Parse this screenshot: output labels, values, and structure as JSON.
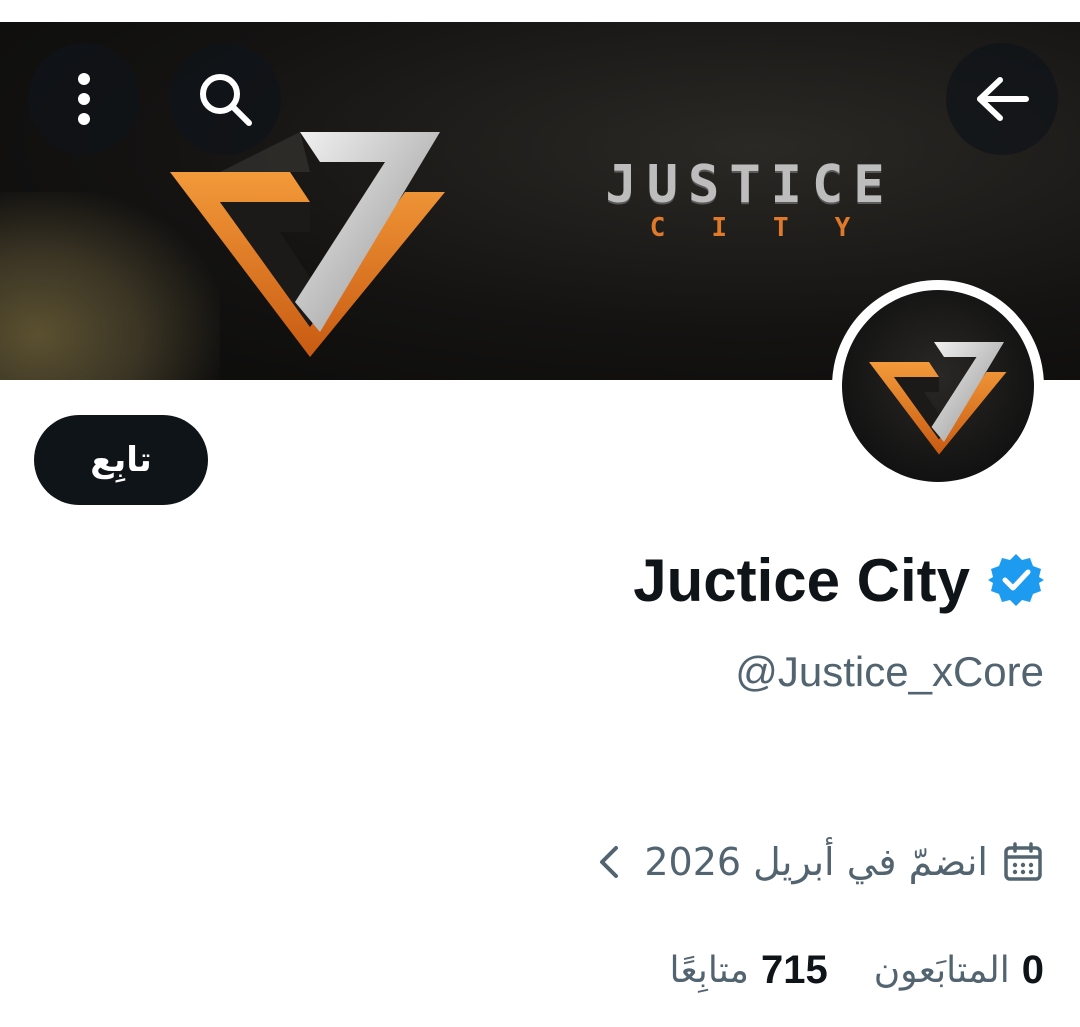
{
  "header": {
    "more_icon": "more-vertical-icon",
    "search_icon": "search-icon",
    "back_icon": "arrow-left-icon"
  },
  "banner": {
    "wordmark_main": "JUSTICE",
    "wordmark_sub": "CITY"
  },
  "profile": {
    "display_name": "Juctice City",
    "handle": "@Justice_xCore",
    "verified_color": "#1d9bf0",
    "follow_label": "تابِع",
    "joined_label": "انضمّ في أبريل 2026",
    "joined_icon": "calendar-icon",
    "followers_count": "0",
    "followers_label": "المتابَعون",
    "following_count": "715",
    "following_label": "متابِعًا"
  },
  "colors": {
    "accent_orange": "#e07a2a",
    "text_primary": "#0f1419",
    "text_secondary": "#536471"
  }
}
